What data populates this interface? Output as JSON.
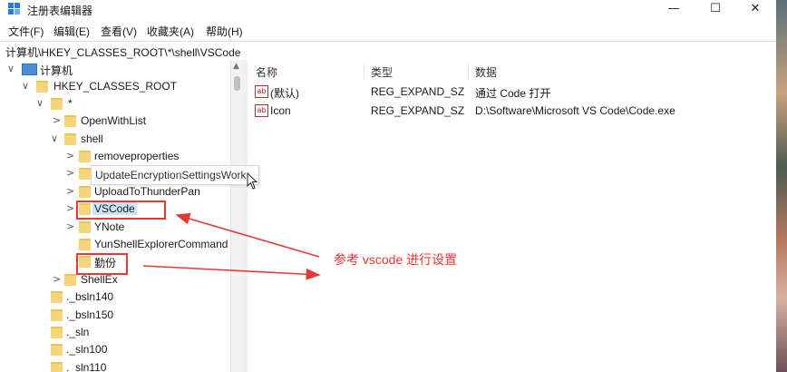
{
  "window": {
    "title": "注册表编辑器",
    "caption_buttons": [
      "—",
      "☐",
      "✕"
    ]
  },
  "menu": [
    "文件(F)",
    "编辑(E)",
    "查看(V)",
    "收藏夹(A)",
    "帮助(H)"
  ],
  "address": "计算机\\HKEY_CLASSES_ROOT\\*\\shell\\VSCode",
  "tree": {
    "nodes": [
      {
        "label": "计算机",
        "chevron": "∨"
      },
      {
        "label": "HKEY_CLASSES_ROOT",
        "chevron": "∨"
      },
      {
        "label": "*",
        "chevron": "∨"
      },
      {
        "label": "OpenWithList",
        "chevron": ">"
      },
      {
        "label": "shell",
        "chevron": "∨"
      },
      {
        "label": "removeproperties",
        "chevron": ">"
      },
      {
        "label": "UpdateEncryptionSettingsWork",
        "chevron": ">"
      },
      {
        "label": "UploadToThunderPan",
        "chevron": ">"
      },
      {
        "label": "VSCode",
        "chevron": ">"
      },
      {
        "label": "YNote",
        "chevron": ">"
      },
      {
        "label": "YunShellExplorerCommand",
        "chevron": ""
      },
      {
        "label": "勤份",
        "chevron": ""
      },
      {
        "label": "ShellEx",
        "chevron": ">"
      },
      {
        "label": "._bsln140",
        "chevron": ""
      },
      {
        "label": "._bsln150",
        "chevron": ""
      },
      {
        "label": "._sln",
        "chevron": ""
      },
      {
        "label": "._sln100",
        "chevron": ""
      },
      {
        "label": "._sln110",
        "chevron": ""
      }
    ]
  },
  "values_pane": {
    "headers": [
      "名称",
      "类型",
      "数据"
    ],
    "rows": [
      {
        "icon": "ab",
        "name": "(默认)",
        "type": "REG_EXPAND_SZ",
        "data": "通过 Code 打开"
      },
      {
        "icon": "ab",
        "name": "Icon",
        "type": "REG_EXPAND_SZ",
        "data": "D:\\Software\\Microsoft VS Code\\Code.exe"
      }
    ]
  },
  "annotation": {
    "text": "参考 vscode 进行设置",
    "color": "#e53935"
  },
  "colors": {
    "selection": "#cce4f7",
    "folder": "#f5d57a",
    "accent_red": "#e53935"
  }
}
